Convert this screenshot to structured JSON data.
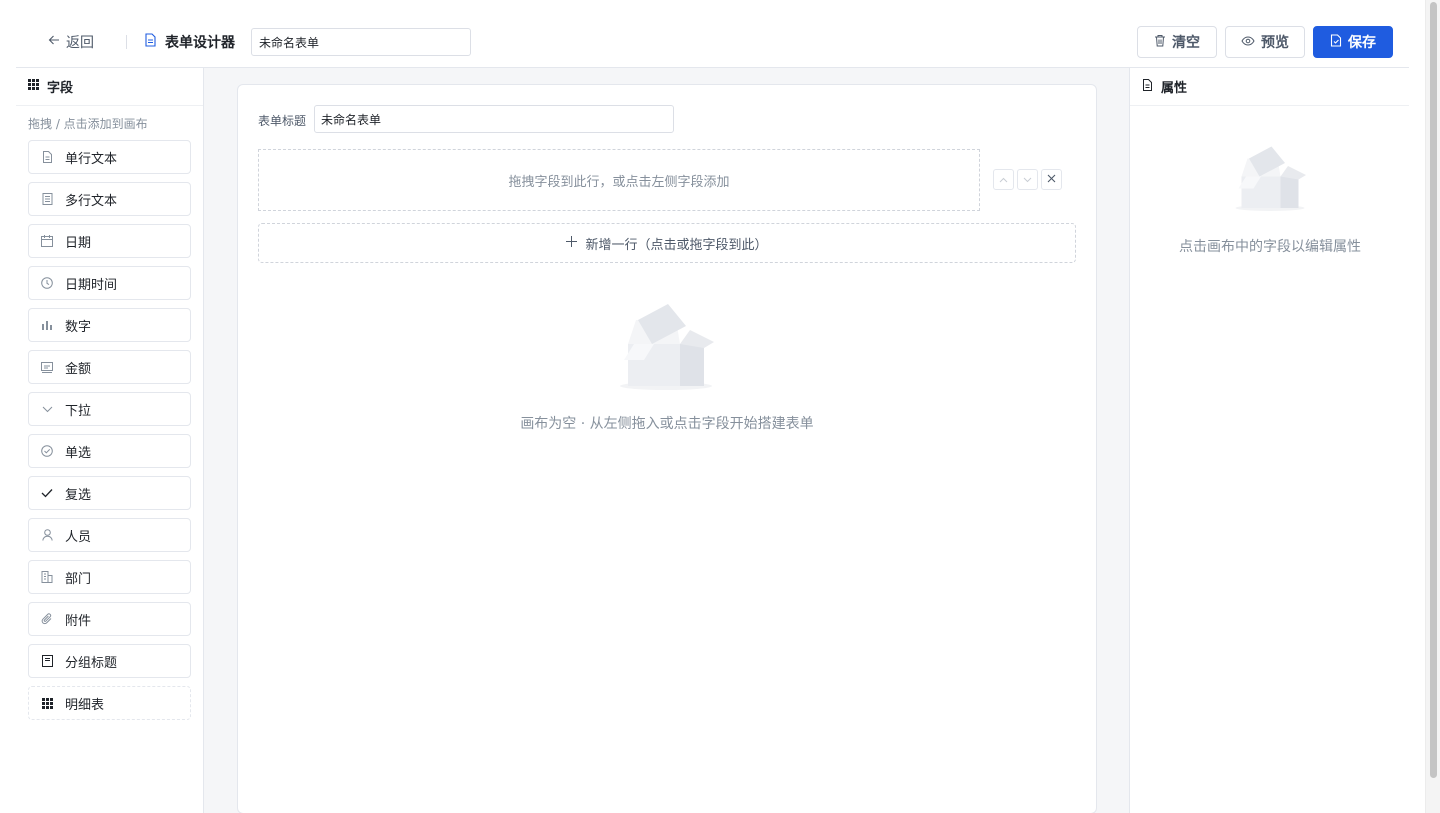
{
  "header": {
    "back_label": "返回",
    "designer_title": "表单设计器",
    "form_name_value": "未命名表单",
    "buttons": {
      "clear": "清空",
      "preview": "预览",
      "save": "保存"
    }
  },
  "fields_panel": {
    "title": "字段",
    "hint": "拖拽 / 点击添加到画布",
    "items": [
      {
        "label": "单行文本",
        "icon": "document-icon"
      },
      {
        "label": "多行文本",
        "icon": "multiline-icon"
      },
      {
        "label": "日期",
        "icon": "calendar-icon"
      },
      {
        "label": "日期时间",
        "icon": "clock-icon"
      },
      {
        "label": "数字",
        "icon": "bar-chart-icon"
      },
      {
        "label": "金额",
        "icon": "money-icon"
      },
      {
        "label": "下拉",
        "icon": "chevron-down-icon"
      },
      {
        "label": "单选",
        "icon": "radio-check-icon"
      },
      {
        "label": "复选",
        "icon": "check-icon"
      },
      {
        "label": "人员",
        "icon": "user-icon"
      },
      {
        "label": "部门",
        "icon": "building-icon"
      },
      {
        "label": "附件",
        "icon": "paperclip-icon"
      },
      {
        "label": "分组标题",
        "icon": "group-title-icon"
      },
      {
        "label": "明细表",
        "icon": "grid-icon"
      }
    ]
  },
  "canvas": {
    "form_title_label": "表单标题",
    "form_title_value": "未命名表单",
    "drop_row_text": "拖拽字段到此行，或点击左侧字段添加",
    "add_row_text": "新增一行（点击或拖字段到此）",
    "empty_text": "画布为空 · 从左侧拖入或点击字段开始搭建表单"
  },
  "properties_panel": {
    "title": "属性",
    "empty_text": "点击画布中的字段以编辑属性"
  },
  "colors": {
    "accent": "#1f5ce0",
    "muted_text": "#86909c",
    "border": "#e4e7ed",
    "canvas_bg": "#f5f6f8"
  }
}
